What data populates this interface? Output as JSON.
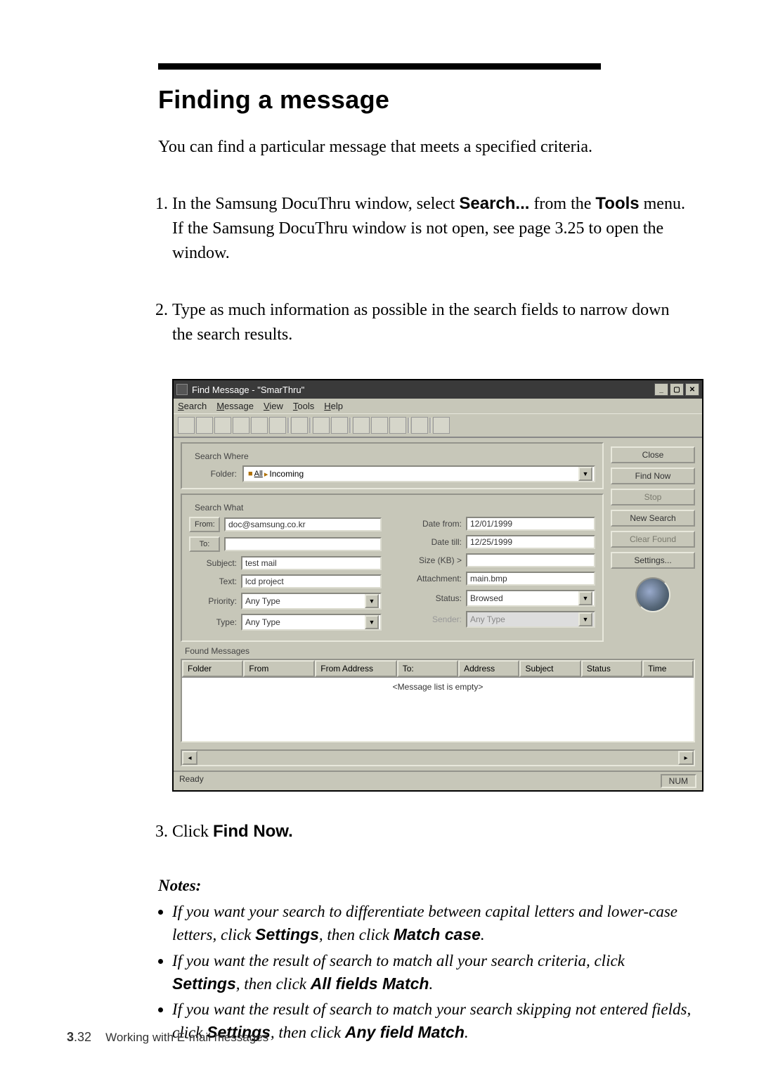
{
  "heading": "Finding a message",
  "intro": "You can find a particular message that meets a specified criteria.",
  "steps": {
    "s1_a": "In the Samsung DocuThru window, select ",
    "s1_b": "Search...",
    "s1_c": " from the ",
    "s1_d": "Tools",
    "s1_e": " menu. If the Samsung DocuThru window is not open, see page 3.25 to open the window.",
    "s2": "Type as much information as possible in the search fields to narrow down the search results.",
    "s3_a": "Click ",
    "s3_b": "Find Now."
  },
  "notes_title": "Notes:",
  "notes": {
    "n1_a": "If you want your search to differentiate between capital letters and lower-case letters, click ",
    "n1_b": "Settings",
    "n1_c": ", then click ",
    "n1_d": "Match case",
    "n1_e": ".",
    "n2_a": "If you want the result of search to match all your search criteria, click ",
    "n2_b": "Settings",
    "n2_c": ", then click ",
    "n2_d": "All fields Match",
    "n2_e": ".",
    "n3_a": "If you want the result of search to match your search skipping not entered fields, click ",
    "n3_b": "Settings",
    "n3_c": ", then click ",
    "n3_d": "Any field Match",
    "n3_e": "."
  },
  "footer": {
    "chapter_num": "3",
    "page_num": ".32",
    "text": "Working with E-mail messages"
  },
  "dialog": {
    "title": "Find Message - \"SmarThru\"",
    "menus": [
      "Search",
      "Message",
      "View",
      "Tools",
      "Help"
    ],
    "section_labels": {
      "search_where": "Search Where",
      "search_what": "Search What",
      "found_messages": "Found Messages"
    },
    "labels": {
      "folder": "Folder:",
      "from": "From:",
      "to": "To:",
      "subject": "Subject:",
      "text": "Text:",
      "priority": "Priority:",
      "type": "Type:",
      "date_from": "Date from:",
      "date_till": "Date till:",
      "size": "Size (KB) >",
      "attachment": "Attachment:",
      "status": "Status:",
      "sender": "Sender:"
    },
    "values": {
      "folder": "Incoming",
      "from": "doc@samsung.co.kr",
      "to": "",
      "subject": "test mail",
      "text": "lcd project",
      "priority": "Any Type",
      "type": "Any Type",
      "date_from": "12/01/1999",
      "date_till": "12/25/1999",
      "size": "",
      "attachment": "main.bmp",
      "status": "Browsed",
      "sender": "Any Type",
      "folder_all": "All"
    },
    "buttons": {
      "close": "Close",
      "find_now": "Find Now",
      "stop": "Stop",
      "new_search": "New Search",
      "clear_found": "Clear Found",
      "settings": "Settings..."
    },
    "columns": [
      "Folder",
      "From",
      "From Address",
      "To:",
      "Address",
      "Subject",
      "Status",
      "Time"
    ],
    "empty": "<Message list is empty>",
    "status_bar": {
      "ready": "Ready",
      "num": "NUM"
    },
    "small_from_btn": "From:",
    "small_to_btn": "To:"
  }
}
